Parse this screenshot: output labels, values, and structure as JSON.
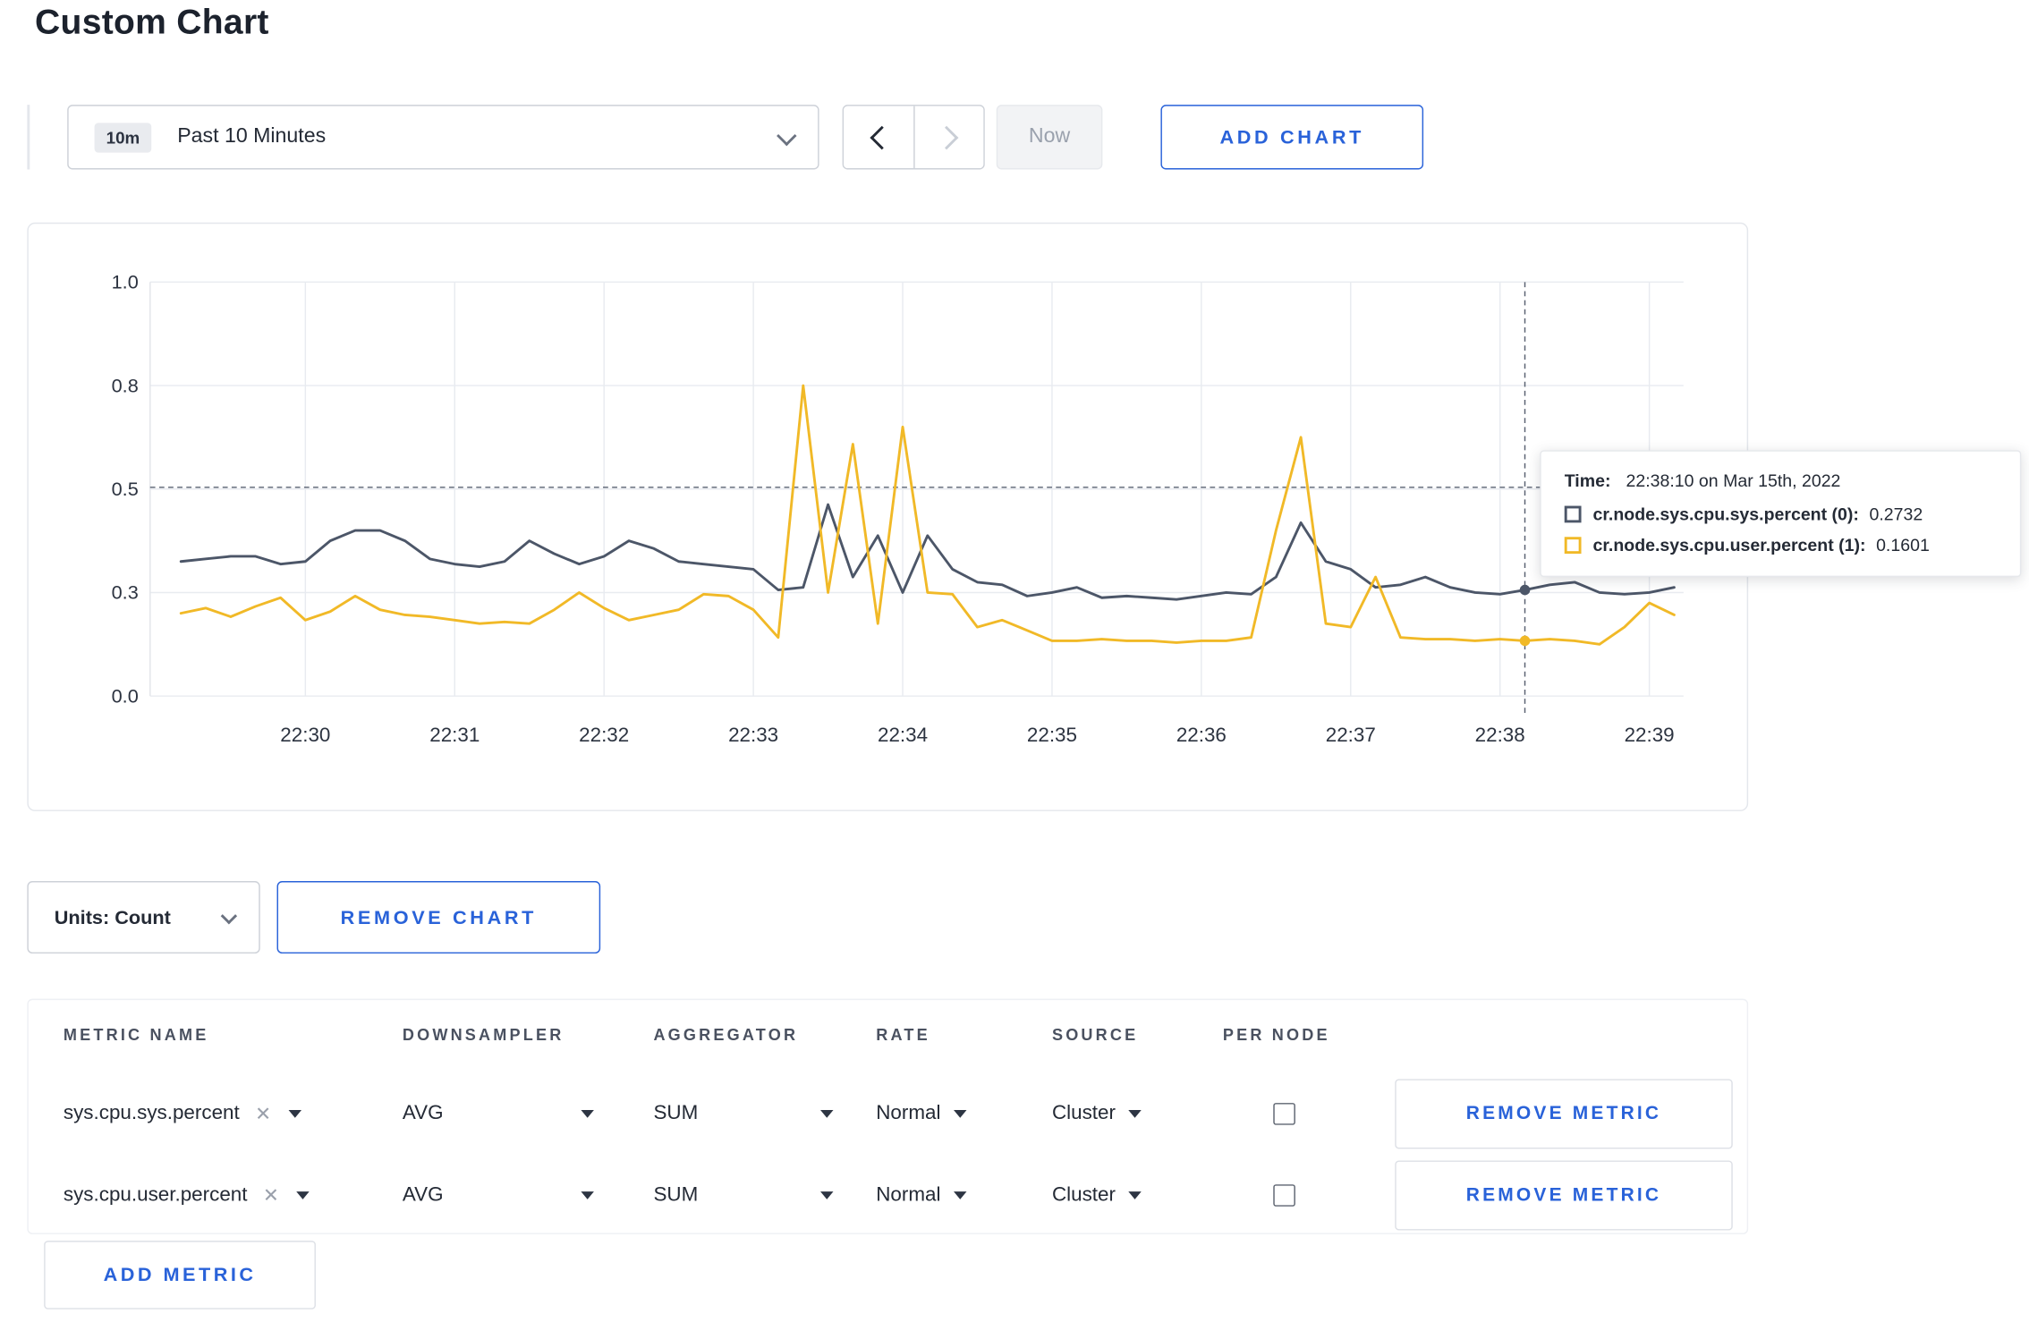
{
  "page": {
    "title": "Custom Chart"
  },
  "colors": {
    "accent_blue": "#2962d9",
    "grid": "#e8ebf0",
    "crosshair": "#586070"
  },
  "toolbar": {
    "range_badge": "10m",
    "range_label": "Past 10 Minutes",
    "now_label": "Now",
    "add_chart_label": "ADD CHART"
  },
  "controls": {
    "units_label": "Units: Count",
    "remove_chart_label": "REMOVE CHART"
  },
  "chart_data": {
    "type": "line",
    "title": "",
    "xlabel": "",
    "ylabel": "",
    "ylim": [
      0.0,
      1.0
    ],
    "grid": true,
    "y_ticks": [
      1.0,
      0.8,
      0.5,
      0.3,
      0.0
    ],
    "y_tick_labels": [
      "1.0",
      "0.8",
      "0.5",
      "0.3",
      "0.0"
    ],
    "x_ticks": [
      "22:30",
      "22:31",
      "22:32",
      "22:33",
      "22:34",
      "22:35",
      "22:36",
      "22:37",
      "22:38",
      "22:39"
    ],
    "x": [
      "22:29:10",
      "22:29:20",
      "22:29:30",
      "22:29:40",
      "22:29:50",
      "22:30:00",
      "22:30:10",
      "22:30:20",
      "22:30:30",
      "22:30:40",
      "22:30:50",
      "22:31:00",
      "22:31:10",
      "22:31:20",
      "22:31:30",
      "22:31:40",
      "22:31:50",
      "22:32:00",
      "22:32:10",
      "22:32:20",
      "22:32:30",
      "22:32:40",
      "22:32:50",
      "22:33:00",
      "22:33:10",
      "22:33:20",
      "22:33:30",
      "22:33:40",
      "22:33:50",
      "22:34:00",
      "22:34:10",
      "22:34:20",
      "22:34:30",
      "22:34:40",
      "22:34:50",
      "22:35:00",
      "22:35:10",
      "22:35:20",
      "22:35:30",
      "22:35:40",
      "22:35:50",
      "22:36:00",
      "22:36:10",
      "22:36:20",
      "22:36:30",
      "22:36:40",
      "22:36:50",
      "22:37:00",
      "22:37:10",
      "22:37:20",
      "22:37:30",
      "22:37:40",
      "22:37:50",
      "22:38:00",
      "22:38:10",
      "22:38:20",
      "22:38:30",
      "22:38:40",
      "22:38:50",
      "22:39:00",
      "22:39:10"
    ],
    "series": [
      {
        "name": "cr.node.sys.cpu.sys.percent",
        "color": "#4c5668",
        "values": [
          0.36,
          0.365,
          0.37,
          0.37,
          0.355,
          0.36,
          0.4,
          0.42,
          0.42,
          0.4,
          0.365,
          0.355,
          0.35,
          0.36,
          0.4,
          0.375,
          0.355,
          0.37,
          0.4,
          0.385,
          0.36,
          0.355,
          0.35,
          0.345,
          0.305,
          0.31,
          0.47,
          0.33,
          0.41,
          0.3,
          0.41,
          0.345,
          0.32,
          0.315,
          0.29,
          0.3,
          0.31,
          0.285,
          0.29,
          0.285,
          0.28,
          0.29,
          0.3,
          0.295,
          0.33,
          0.435,
          0.36,
          0.345,
          0.31,
          0.315,
          0.33,
          0.31,
          0.3,
          0.295,
          0.305,
          0.315,
          0.32,
          0.3,
          0.295,
          0.3,
          0.31
        ]
      },
      {
        "name": "cr.node.sys.cpu.user.percent",
        "color": "#f1b927",
        "values": [
          0.24,
          0.255,
          0.23,
          0.26,
          0.285,
          0.22,
          0.245,
          0.29,
          0.25,
          0.235,
          0.23,
          0.22,
          0.21,
          0.215,
          0.21,
          0.25,
          0.3,
          0.255,
          0.22,
          0.235,
          0.25,
          0.295,
          0.29,
          0.25,
          0.17,
          0.8,
          0.3,
          0.63,
          0.21,
          0.68,
          0.3,
          0.295,
          0.2,
          0.22,
          0.19,
          0.16,
          0.16,
          0.165,
          0.16,
          0.16,
          0.155,
          0.16,
          0.16,
          0.17,
          0.42,
          0.65,
          0.21,
          0.2,
          0.33,
          0.17,
          0.165,
          0.165,
          0.16,
          0.165,
          0.16,
          0.165,
          0.16,
          0.15,
          0.2,
          0.27,
          0.235
        ]
      }
    ],
    "crosshair": {
      "time": "22:38:10",
      "hline_value": 0.505
    },
    "tooltip": {
      "time_label": "Time:",
      "time_value": "22:38:10 on Mar 15th, 2022",
      "rows": [
        {
          "label": "cr.node.sys.cpu.sys.percent (0):",
          "value": "0.2732"
        },
        {
          "label": "cr.node.sys.cpu.user.percent (1):",
          "value": "0.1601"
        }
      ]
    },
    "legend_position": "tooltip"
  },
  "metrics_table": {
    "headers": [
      "METRIC NAME",
      "DOWNSAMPLER",
      "AGGREGATOR",
      "RATE",
      "SOURCE",
      "PER NODE"
    ],
    "rows": [
      {
        "metric": "sys.cpu.sys.percent",
        "clear": "✕",
        "downsampler": "AVG",
        "aggregator": "SUM",
        "rate": "Normal",
        "source": "Cluster",
        "per_node_checked": false,
        "remove_label": "REMOVE METRIC"
      },
      {
        "metric": "sys.cpu.user.percent",
        "clear": "✕",
        "downsampler": "AVG",
        "aggregator": "SUM",
        "rate": "Normal",
        "source": "Cluster",
        "per_node_checked": false,
        "remove_label": "REMOVE METRIC"
      }
    ],
    "add_metric_label": "ADD METRIC"
  }
}
